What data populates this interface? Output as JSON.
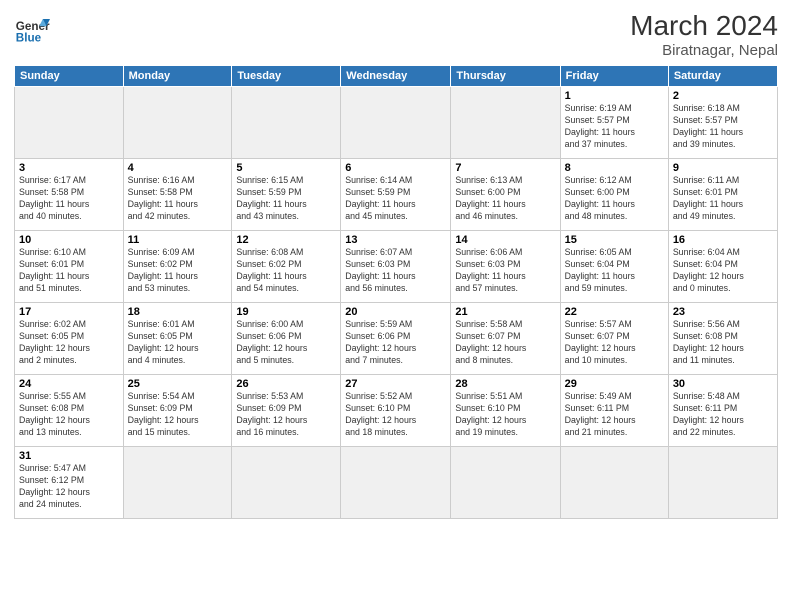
{
  "header": {
    "logo_text_general": "General",
    "logo_text_blue": "Blue",
    "month_year": "March 2024",
    "location": "Biratnagar, Nepal"
  },
  "columns": [
    "Sunday",
    "Monday",
    "Tuesday",
    "Wednesday",
    "Thursday",
    "Friday",
    "Saturday"
  ],
  "weeks": [
    {
      "days": [
        {
          "num": "",
          "info": "",
          "empty": true
        },
        {
          "num": "",
          "info": "",
          "empty": true
        },
        {
          "num": "",
          "info": "",
          "empty": true
        },
        {
          "num": "",
          "info": "",
          "empty": true
        },
        {
          "num": "",
          "info": "",
          "empty": true
        },
        {
          "num": "1",
          "info": "Sunrise: 6:19 AM\nSunset: 5:57 PM\nDaylight: 11 hours\nand 37 minutes."
        },
        {
          "num": "2",
          "info": "Sunrise: 6:18 AM\nSunset: 5:57 PM\nDaylight: 11 hours\nand 39 minutes."
        }
      ]
    },
    {
      "days": [
        {
          "num": "3",
          "info": "Sunrise: 6:17 AM\nSunset: 5:58 PM\nDaylight: 11 hours\nand 40 minutes."
        },
        {
          "num": "4",
          "info": "Sunrise: 6:16 AM\nSunset: 5:58 PM\nDaylight: 11 hours\nand 42 minutes."
        },
        {
          "num": "5",
          "info": "Sunrise: 6:15 AM\nSunset: 5:59 PM\nDaylight: 11 hours\nand 43 minutes."
        },
        {
          "num": "6",
          "info": "Sunrise: 6:14 AM\nSunset: 5:59 PM\nDaylight: 11 hours\nand 45 minutes."
        },
        {
          "num": "7",
          "info": "Sunrise: 6:13 AM\nSunset: 6:00 PM\nDaylight: 11 hours\nand 46 minutes."
        },
        {
          "num": "8",
          "info": "Sunrise: 6:12 AM\nSunset: 6:00 PM\nDaylight: 11 hours\nand 48 minutes."
        },
        {
          "num": "9",
          "info": "Sunrise: 6:11 AM\nSunset: 6:01 PM\nDaylight: 11 hours\nand 49 minutes."
        }
      ]
    },
    {
      "days": [
        {
          "num": "10",
          "info": "Sunrise: 6:10 AM\nSunset: 6:01 PM\nDaylight: 11 hours\nand 51 minutes."
        },
        {
          "num": "11",
          "info": "Sunrise: 6:09 AM\nSunset: 6:02 PM\nDaylight: 11 hours\nand 53 minutes."
        },
        {
          "num": "12",
          "info": "Sunrise: 6:08 AM\nSunset: 6:02 PM\nDaylight: 11 hours\nand 54 minutes."
        },
        {
          "num": "13",
          "info": "Sunrise: 6:07 AM\nSunset: 6:03 PM\nDaylight: 11 hours\nand 56 minutes."
        },
        {
          "num": "14",
          "info": "Sunrise: 6:06 AM\nSunset: 6:03 PM\nDaylight: 11 hours\nand 57 minutes."
        },
        {
          "num": "15",
          "info": "Sunrise: 6:05 AM\nSunset: 6:04 PM\nDaylight: 11 hours\nand 59 minutes."
        },
        {
          "num": "16",
          "info": "Sunrise: 6:04 AM\nSunset: 6:04 PM\nDaylight: 12 hours\nand 0 minutes."
        }
      ]
    },
    {
      "days": [
        {
          "num": "17",
          "info": "Sunrise: 6:02 AM\nSunset: 6:05 PM\nDaylight: 12 hours\nand 2 minutes."
        },
        {
          "num": "18",
          "info": "Sunrise: 6:01 AM\nSunset: 6:05 PM\nDaylight: 12 hours\nand 4 minutes."
        },
        {
          "num": "19",
          "info": "Sunrise: 6:00 AM\nSunset: 6:06 PM\nDaylight: 12 hours\nand 5 minutes."
        },
        {
          "num": "20",
          "info": "Sunrise: 5:59 AM\nSunset: 6:06 PM\nDaylight: 12 hours\nand 7 minutes."
        },
        {
          "num": "21",
          "info": "Sunrise: 5:58 AM\nSunset: 6:07 PM\nDaylight: 12 hours\nand 8 minutes."
        },
        {
          "num": "22",
          "info": "Sunrise: 5:57 AM\nSunset: 6:07 PM\nDaylight: 12 hours\nand 10 minutes."
        },
        {
          "num": "23",
          "info": "Sunrise: 5:56 AM\nSunset: 6:08 PM\nDaylight: 12 hours\nand 11 minutes."
        }
      ]
    },
    {
      "days": [
        {
          "num": "24",
          "info": "Sunrise: 5:55 AM\nSunset: 6:08 PM\nDaylight: 12 hours\nand 13 minutes."
        },
        {
          "num": "25",
          "info": "Sunrise: 5:54 AM\nSunset: 6:09 PM\nDaylight: 12 hours\nand 15 minutes."
        },
        {
          "num": "26",
          "info": "Sunrise: 5:53 AM\nSunset: 6:09 PM\nDaylight: 12 hours\nand 16 minutes."
        },
        {
          "num": "27",
          "info": "Sunrise: 5:52 AM\nSunset: 6:10 PM\nDaylight: 12 hours\nand 18 minutes."
        },
        {
          "num": "28",
          "info": "Sunrise: 5:51 AM\nSunset: 6:10 PM\nDaylight: 12 hours\nand 19 minutes."
        },
        {
          "num": "29",
          "info": "Sunrise: 5:49 AM\nSunset: 6:11 PM\nDaylight: 12 hours\nand 21 minutes."
        },
        {
          "num": "30",
          "info": "Sunrise: 5:48 AM\nSunset: 6:11 PM\nDaylight: 12 hours\nand 22 minutes."
        }
      ]
    },
    {
      "days": [
        {
          "num": "31",
          "info": "Sunrise: 5:47 AM\nSunset: 6:12 PM\nDaylight: 12 hours\nand 24 minutes."
        },
        {
          "num": "",
          "info": "",
          "empty": true
        },
        {
          "num": "",
          "info": "",
          "empty": true
        },
        {
          "num": "",
          "info": "",
          "empty": true
        },
        {
          "num": "",
          "info": "",
          "empty": true
        },
        {
          "num": "",
          "info": "",
          "empty": true
        },
        {
          "num": "",
          "info": "",
          "empty": true
        }
      ]
    }
  ]
}
